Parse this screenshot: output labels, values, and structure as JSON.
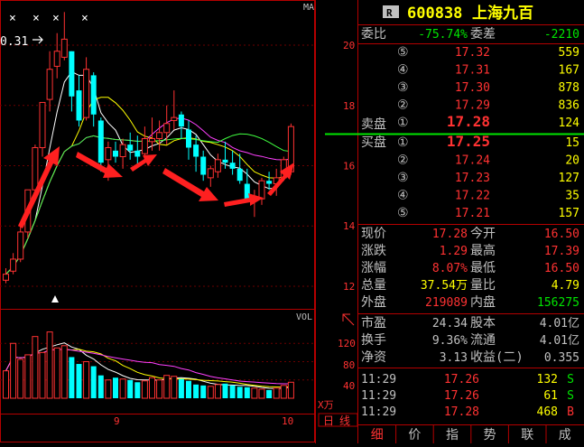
{
  "top_bar": {
    "close_marks": [
      "×",
      "×",
      "×",
      "×"
    ],
    "ma_label": "MA",
    "max_price_tag": "0.31"
  },
  "price_axis": {
    "ticks": [
      "20",
      "18",
      "16",
      "14",
      "12"
    ],
    "values": [
      20,
      18,
      16,
      14,
      12
    ],
    "range": [
      11.25,
      21.35
    ]
  },
  "volume_axis": {
    "label": "VOL",
    "ticks": [
      "120",
      "80",
      "40"
    ],
    "values": [
      120,
      80,
      40
    ],
    "unit": "X万",
    "max": 160
  },
  "date_axis": {
    "labels": [
      "9",
      "10"
    ]
  },
  "bottom_tabs": [
    "日",
    "线"
  ],
  "chart_data": {
    "type": "candlestick",
    "ohlc": [
      [
        12.2,
        12.6,
        12.1,
        12.4
      ],
      [
        12.5,
        13.1,
        12.4,
        12.9
      ],
      [
        12.9,
        14.0,
        12.8,
        13.8
      ],
      [
        13.8,
        15.2,
        13.6,
        15.2
      ],
      [
        15.2,
        16.7,
        15.0,
        16.6
      ],
      [
        16.6,
        18.1,
        16.3,
        18.1
      ],
      [
        18.2,
        19.8,
        17.8,
        19.2
      ],
      [
        19.3,
        20.4,
        18.9,
        19.8
      ],
      [
        19.6,
        21.1,
        19.5,
        20.2
      ],
      [
        19.8,
        19.8,
        17.8,
        18.3
      ],
      [
        18.5,
        19.0,
        17.3,
        17.5
      ],
      [
        17.6,
        19.6,
        17.5,
        19.2
      ],
      [
        19.0,
        19.1,
        17.3,
        17.7
      ],
      [
        17.5,
        17.6,
        15.8,
        16.1
      ],
      [
        16.2,
        16.8,
        15.5,
        16.6
      ],
      [
        16.5,
        16.8,
        16.1,
        16.3
      ],
      [
        16.3,
        16.9,
        15.9,
        16.7
      ],
      [
        16.7,
        17.1,
        16.2,
        16.5
      ],
      [
        16.5,
        17.0,
        16.0,
        16.3
      ],
      [
        16.4,
        17.3,
        16.1,
        16.9
      ],
      [
        16.8,
        17.6,
        16.5,
        16.9
      ],
      [
        16.9,
        17.5,
        16.5,
        17.1
      ],
      [
        17.1,
        18.0,
        16.7,
        17.4
      ],
      [
        17.5,
        18.5,
        17.2,
        17.6
      ],
      [
        17.7,
        17.8,
        16.9,
        17.3
      ],
      [
        17.2,
        17.5,
        16.2,
        16.6
      ],
      [
        16.7,
        17.0,
        15.8,
        16.3
      ],
      [
        16.3,
        16.5,
        15.5,
        15.7
      ],
      [
        15.6,
        16.0,
        15.3,
        15.9
      ],
      [
        15.8,
        16.4,
        15.6,
        16.2
      ],
      [
        16.2,
        16.8,
        15.9,
        16.1
      ],
      [
        16.1,
        16.5,
        15.7,
        15.9
      ],
      [
        15.9,
        16.4,
        15.4,
        15.5
      ],
      [
        15.4,
        15.9,
        14.8,
        14.9
      ],
      [
        14.9,
        15.2,
        14.3,
        14.9
      ],
      [
        14.9,
        15.6,
        14.7,
        15.5
      ],
      [
        15.5,
        15.8,
        15.2,
        15.4
      ],
      [
        15.4,
        15.9,
        15.0,
        15.6
      ],
      [
        15.6,
        16.3,
        15.5,
        16.2
      ],
      [
        15.8,
        17.4,
        15.7,
        17.3
      ]
    ],
    "volume": [
      60,
      120,
      85,
      95,
      135,
      100,
      145,
      110,
      115,
      90,
      75,
      80,
      70,
      50,
      40,
      45,
      42,
      40,
      35,
      38,
      45,
      40,
      50,
      48,
      42,
      38,
      30,
      28,
      26,
      30,
      32,
      28,
      25,
      24,
      22,
      20,
      18,
      22,
      28,
      35
    ],
    "price_range": [
      11.25,
      21.35
    ],
    "volume_max": 160
  },
  "quote": {
    "badge": "R",
    "code": "600838",
    "name": "上海九百",
    "weibi_label": "委比",
    "weibi_value": "-75.74%",
    "weicha_label": "委差",
    "weicha_value": "-2210",
    "sell_label": "卖盘",
    "buy_label": "买盘",
    "sell_levels": [
      {
        "num": "⑤",
        "price": "17.32",
        "vol": "559"
      },
      {
        "num": "④",
        "price": "17.31",
        "vol": "167"
      },
      {
        "num": "③",
        "price": "17.30",
        "vol": "878"
      },
      {
        "num": "②",
        "price": "17.29",
        "vol": "836"
      },
      {
        "num": "①",
        "price": "17.28",
        "vol": "124"
      }
    ],
    "buy_levels": [
      {
        "num": "①",
        "price": "17.25",
        "vol": "15"
      },
      {
        "num": "②",
        "price": "17.24",
        "vol": "20"
      },
      {
        "num": "③",
        "price": "17.23",
        "vol": "127"
      },
      {
        "num": "④",
        "price": "17.22",
        "vol": "35"
      },
      {
        "num": "⑤",
        "price": "17.21",
        "vol": "157"
      }
    ],
    "stats": [
      {
        "l1": "现价",
        "v1": "17.28",
        "l2": "今开",
        "v2": "16.50",
        "c1": "red",
        "c2": "red"
      },
      {
        "l1": "涨跌",
        "v1": "1.29",
        "l2": "最高",
        "v2": "17.39",
        "c1": "red",
        "c2": "red"
      },
      {
        "l1": "涨幅",
        "v1": "8.07%",
        "l2": "最低",
        "v2": "16.50",
        "c1": "red",
        "c2": "red"
      },
      {
        "l1": "总量",
        "v1": "37.54万",
        "l2": "量比",
        "v2": "4.79",
        "c1": "yellow",
        "c2": "yellow"
      },
      {
        "l1": "外盘",
        "v1": "219089",
        "l2": "内盘",
        "v2": "156275",
        "c1": "red",
        "c2": "green"
      }
    ],
    "stats2": [
      {
        "l1": "市盈",
        "v1": "24.34",
        "l2": "股本",
        "v2": "4.01亿"
      },
      {
        "l1": "换手",
        "v1": "9.36%",
        "l2": "流通",
        "v2": "4.01亿"
      },
      {
        "l1": "净资",
        "v1": "3.13",
        "l2": "收益(二)",
        "v2": "0.355"
      }
    ],
    "ticks": [
      {
        "time": "11:29",
        "price": "17.26",
        "vol": "132",
        "flag": "S"
      },
      {
        "time": "11:29",
        "price": "17.26",
        "vol": "61",
        "flag": "S"
      },
      {
        "time": "11:29",
        "price": "17.28",
        "vol": "468",
        "flag": "B"
      }
    ],
    "tabs": [
      "细",
      "价",
      "指",
      "势",
      "联",
      "成"
    ]
  },
  "colors": {
    "up": "#ff3232",
    "down": "#00ffff",
    "grid_red": "#a00000",
    "yellow": "#ffff00",
    "green": "#00e600",
    "text_gray": "#c0c0c0"
  }
}
